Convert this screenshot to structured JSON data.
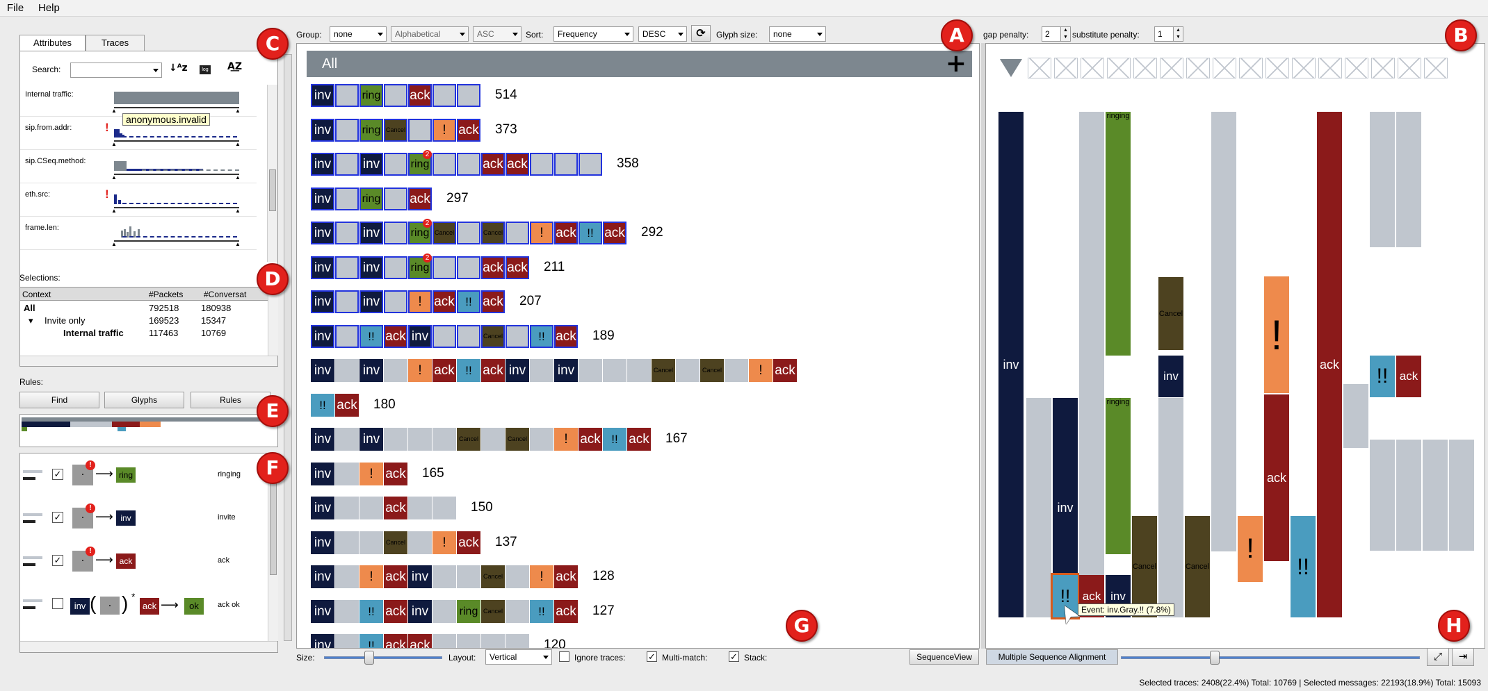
{
  "menu": {
    "file": "File",
    "help": "Help"
  },
  "left": {
    "tabs": [
      "Attributes",
      "Traces"
    ],
    "search_label": "Search:",
    "attributes": [
      {
        "name": "Internal traffic:",
        "flag": false
      },
      {
        "name": "sip.from.addr:",
        "flag": true
      },
      {
        "name": "sip.CSeq.method:",
        "flag": false
      },
      {
        "name": "eth.src:",
        "flag": true
      },
      {
        "name": "frame.len:",
        "flag": false
      }
    ],
    "tooltip": "anonymous.invalid",
    "selections_label": "Selections:",
    "sel_headers": [
      "Context",
      "#Packets",
      "#Conversat"
    ],
    "sel_rows": [
      {
        "context": "All",
        "packets": "792518",
        "conv": "180938"
      },
      {
        "context": "Invite only",
        "packets": "169523",
        "conv": "15347"
      },
      {
        "context": "Internal traffic",
        "packets": "117463",
        "conv": "10769"
      }
    ],
    "rules_label": "Rules:",
    "rule_buttons": [
      "Find",
      "Glyphs",
      "Rules"
    ],
    "rules": [
      {
        "target": "ring",
        "label": "ringing",
        "checked": true,
        "color": "#5a8a28"
      },
      {
        "target": "inv",
        "label": "invite",
        "checked": true,
        "color": "#0f1a3e"
      },
      {
        "target": "ack",
        "label": "ack",
        "checked": true,
        "color": "#8b1a1a"
      },
      {
        "target": "ok",
        "label": "ack ok",
        "checked": false,
        "color": "#5a8a28"
      }
    ],
    "rule4_parts": [
      "inv",
      "ack",
      "ok"
    ]
  },
  "toolbar": {
    "group_label": "Group:",
    "group_value": "none",
    "order_value": "Alphabetical",
    "dir_value": "ASC",
    "sort_label": "Sort:",
    "sort_value": "Frequency",
    "sort_dir": "DESC",
    "glyph_label": "Glyph size:",
    "glyph_value": "none",
    "gap_label": "gap penalty:",
    "gap_value": "2",
    "sub_label": "substitute penalty:",
    "sub_value": "1"
  },
  "center": {
    "all_label": "All",
    "rows": [
      {
        "count": "514",
        "glyphs": [
          "inv",
          "g",
          "ring",
          "g",
          "ack",
          "g",
          "g"
        ]
      },
      {
        "count": "373",
        "glyphs": [
          "inv",
          "g",
          "ring",
          "cancel",
          "g",
          "!",
          "ack"
        ]
      },
      {
        "count": "358",
        "glyphs": [
          "inv",
          "g",
          "inv",
          "g",
          "ring2",
          "g",
          "g",
          "ack",
          "ack",
          "g",
          "g",
          "g"
        ]
      },
      {
        "count": "297",
        "glyphs": [
          "inv",
          "g",
          "ring",
          "g",
          "ack"
        ]
      },
      {
        "count": "292",
        "glyphs": [
          "inv",
          "g",
          "inv",
          "g",
          "ring2",
          "cancel",
          "g",
          "cancel",
          "g",
          "!",
          "ack",
          "!!",
          "ack"
        ]
      },
      {
        "count": "211",
        "glyphs": [
          "inv",
          "g",
          "inv",
          "g",
          "ring2",
          "g",
          "g",
          "ack",
          "ack"
        ]
      },
      {
        "count": "207",
        "glyphs": [
          "inv",
          "g",
          "inv",
          "g",
          "!",
          "ack",
          "!!",
          "ack"
        ]
      },
      {
        "count": "189",
        "glyphs": [
          "inv",
          "g",
          "!!",
          "ack",
          "inv",
          "g",
          "g",
          "cancel",
          "g",
          "!!",
          "ack"
        ]
      },
      {
        "count": "",
        "glyphs": [
          "inv",
          "g",
          "inv",
          "g",
          "!",
          "ack",
          "!!",
          "ack",
          "inv",
          "g",
          "inv",
          "g",
          "g",
          "g",
          "cancel",
          "g",
          "cancel",
          "g",
          "!",
          "ack"
        ]
      },
      {
        "count": "180",
        "glyphs": [
          "!!",
          "ack"
        ]
      },
      {
        "count": "167",
        "glyphs": [
          "inv",
          "g",
          "inv",
          "g",
          "g",
          "g",
          "cancel",
          "g",
          "cancel",
          "g",
          "!",
          "ack",
          "!!",
          "ack"
        ]
      },
      {
        "count": "165",
        "glyphs": [
          "inv",
          "g",
          "!",
          "ack"
        ]
      },
      {
        "count": "150",
        "glyphs": [
          "inv",
          "g",
          "g",
          "ack",
          "g",
          "g"
        ]
      },
      {
        "count": "137",
        "glyphs": [
          "inv",
          "g",
          "g",
          "cancel",
          "g",
          "!",
          "ack"
        ]
      },
      {
        "count": "128",
        "glyphs": [
          "inv",
          "g",
          "!",
          "ack",
          "inv",
          "g",
          "g",
          "cancel",
          "g",
          "!",
          "ack"
        ]
      },
      {
        "count": "127",
        "glyphs": [
          "inv",
          "g",
          "!!",
          "ack",
          "inv",
          "g",
          "ring",
          "cancel",
          "g",
          "!!",
          "ack"
        ]
      },
      {
        "count": "120",
        "glyphs": [
          "inv",
          "g",
          "!!",
          "ack",
          "ack",
          "g",
          "g",
          "g",
          "g"
        ]
      }
    ],
    "bottom": {
      "size_label": "Size:",
      "layout_label": "Layout:",
      "layout_value": "Vertical",
      "ignore_label": "Ignore traces:",
      "multi_label": "Multi-match:",
      "stack_label": "Stack:",
      "seqview": "SequenceView"
    }
  },
  "right": {
    "msa_button": "Multiple Sequence Alignment",
    "tooltip": "Event: inv.Gray.!! (7.8%)"
  },
  "status": "Selected traces: 2408(22.4%) Total: 10769 | Selected messages: 22193(18.9%) Total: 15093",
  "annotations": [
    "A",
    "B",
    "C",
    "D",
    "E",
    "F",
    "G",
    "H"
  ],
  "glyph_text": {
    "inv": "inv",
    "ack": "ack",
    "ring": "ring",
    "cancel": "Cancel",
    "bang": "!",
    "bang2": "!!",
    "ok": "ok",
    "ringing": "ringing",
    "badge": "2"
  },
  "colors": {
    "inv": "#0f1a3e",
    "ack": "#8b1a1a",
    "ring": "#5a8a28",
    "cancel": "#4d4220",
    "bang": "#ee8a4c",
    "bang2": "#4a9cbf",
    "gray": "#c0c6ce",
    "header": "#7d878f",
    "red": "#e2211c"
  }
}
